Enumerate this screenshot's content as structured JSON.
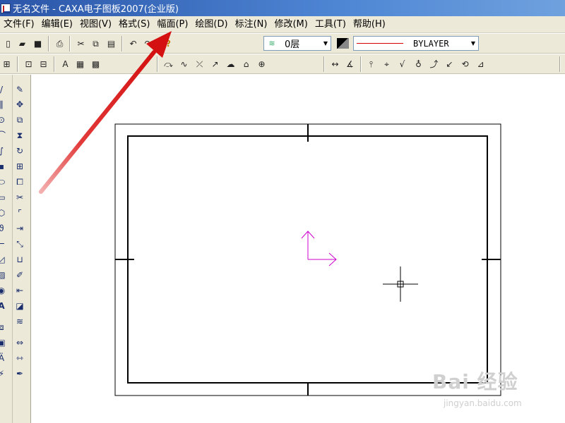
{
  "window": {
    "title": "无名文件 - CAXA电子图板2007(企业版)"
  },
  "menubar": {
    "items": [
      {
        "label": "文件(F)"
      },
      {
        "label": "编辑(E)"
      },
      {
        "label": "视图(V)"
      },
      {
        "label": "格式(S)"
      },
      {
        "label": "幅面(P)"
      },
      {
        "label": "绘图(D)"
      },
      {
        "label": "标注(N)"
      },
      {
        "label": "修改(M)"
      },
      {
        "label": "工具(T)"
      },
      {
        "label": "帮助(H)"
      }
    ]
  },
  "toolbar": {
    "layer_value": "0层",
    "linetype_value": "BYLAYER",
    "line_color": "#d40000"
  },
  "watermark": {
    "text": "Bai 经验",
    "url": "jingyan.baidu.com"
  },
  "colors": {
    "titlebar": "#2b55a8",
    "chrome": "#ece9d8",
    "axis_marker": "#cc00cc",
    "annotation_arrow": "#e02020"
  }
}
